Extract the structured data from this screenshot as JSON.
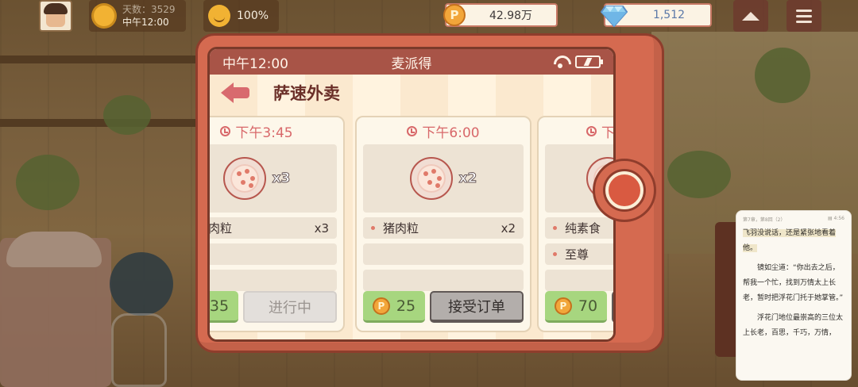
{
  "hud": {
    "days_label": "天数：3529",
    "time_label": "中午12:00",
    "mood": "100%",
    "coins": "42.98万",
    "gems": "1,512"
  },
  "phone": {
    "status_time": "中午12:00",
    "app_name": "麦派得",
    "page_title": "萨速外卖"
  },
  "orders": [
    {
      "time": "下午3:45",
      "qty": "x3",
      "items": [
        {
          "name": "猪肉粒",
          "qty": "x3"
        }
      ],
      "reward": "35",
      "action": "进行中",
      "state": "in-progress"
    },
    {
      "time": "下午6:00",
      "qty": "x2",
      "items": [
        {
          "name": "猪肉粒",
          "qty": "x2"
        }
      ],
      "reward": "25",
      "action": "接受订单",
      "state": "available"
    },
    {
      "time": "下",
      "qty": "",
      "items": [
        {
          "name": "纯素食",
          "qty": ""
        },
        {
          "name": "至尊",
          "qty": ""
        }
      ],
      "reward": "70",
      "action": "",
      "state": "available"
    }
  ],
  "reader": {
    "header_left": "第7章，第8回（2）",
    "header_right": "▤ 4:56",
    "paragraphs": [
      "飞羽没说话，还是紧张地看着他。",
      "镜如尘道：“你出去之后，帮我一个忙，找到万情太上长老，暂时把浮花门托于她掌管。”",
      "浮花门地位最崇高的三位太上长老，百思，千巧，万情，"
    ]
  },
  "colors": {
    "phone_body": "#d56a50",
    "status_bar": "#a85447",
    "accent_red": "#d8686a",
    "reward_green": "#a7d67f"
  }
}
